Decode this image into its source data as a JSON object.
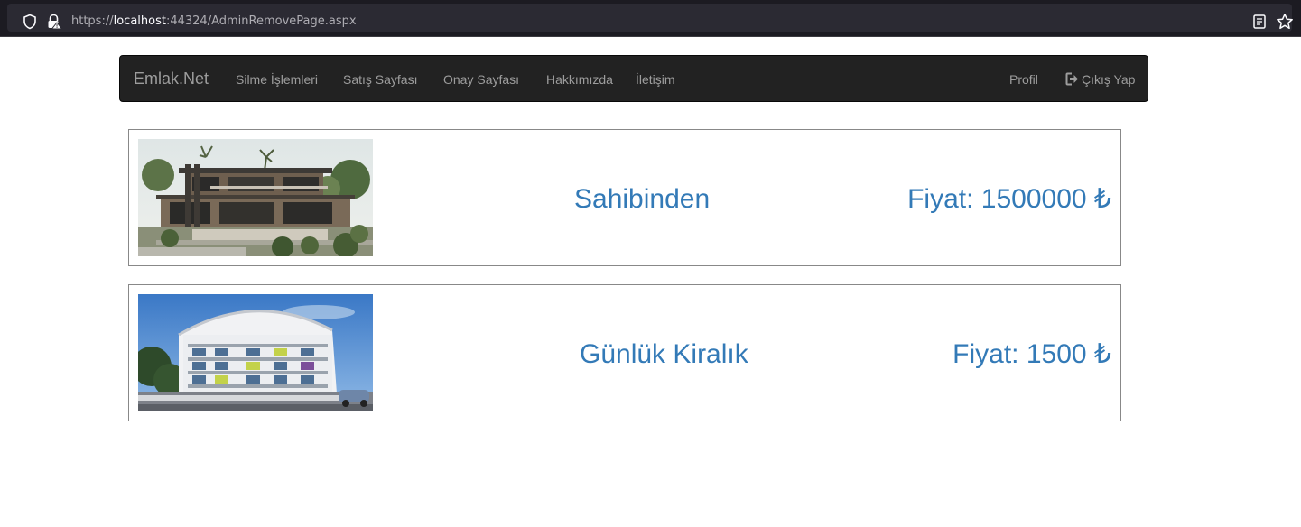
{
  "browser": {
    "url_prefix": "https://",
    "url_host": "localhost",
    "url_rest": ":44324/AdminRemovePage.aspx",
    "icons": [
      "shield-icon",
      "lock-warning-icon",
      "reader-view-icon",
      "bookmark-star-icon"
    ]
  },
  "navbar": {
    "brand": "Emlak.Net",
    "links": [
      "Silme İşlemleri",
      "Satış Sayfası",
      "Onay Sayfası",
      "Hakkımızda",
      "İletişim"
    ],
    "right_links": {
      "profile": "Profil",
      "logout": "Çıkış Yap"
    },
    "logout_icon": "logout-icon",
    "colors": {
      "background": "#222222",
      "text": "#9d9d9d"
    }
  },
  "listings": [
    {
      "title": "Sahibinden",
      "price": "Fiyat: 1500000 ₺",
      "image": "villa-photo"
    },
    {
      "title": "Günlük Kiralık",
      "price": "Fiyat: 1500 ₺",
      "image": "apartment-building-photo"
    }
  ],
  "colors": {
    "link_blue": "#337ab7",
    "border": "#888888"
  }
}
